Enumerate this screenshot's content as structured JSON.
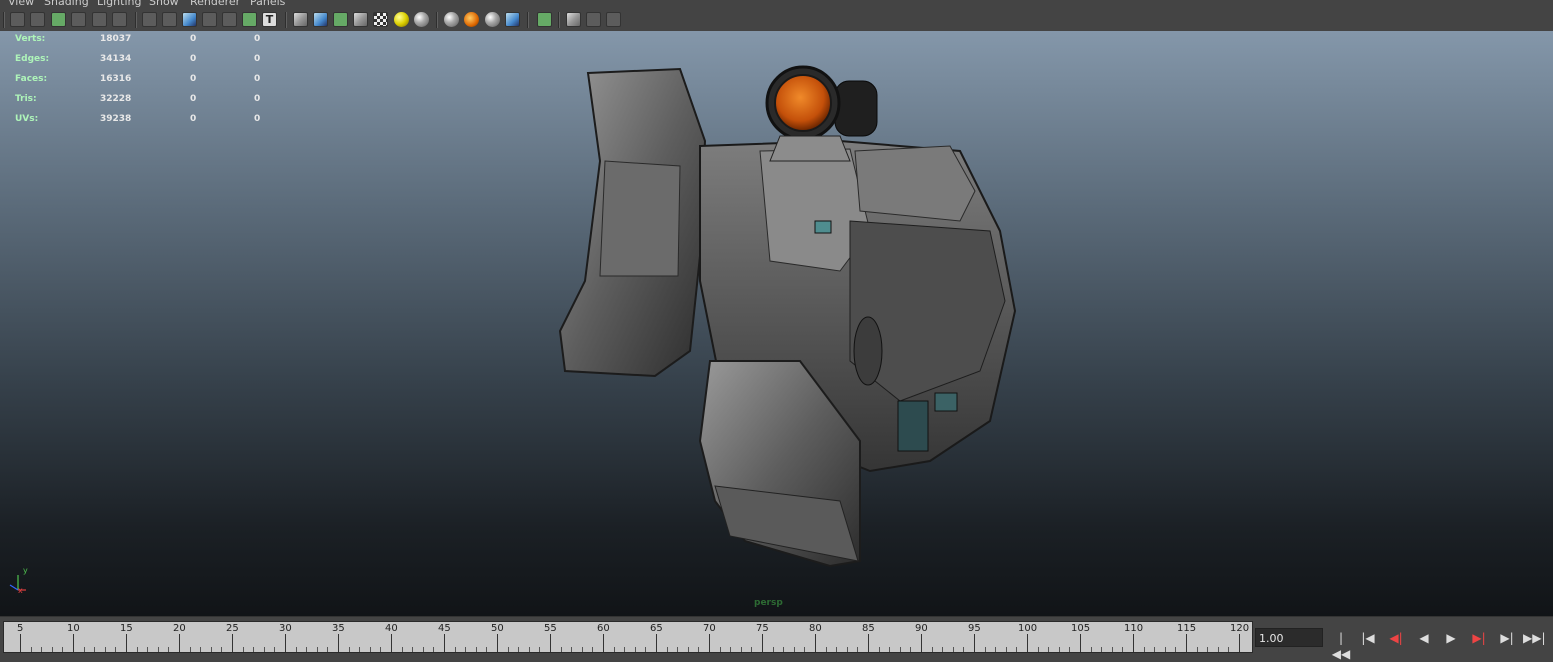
{
  "menu": [
    "View",
    "Shading",
    "Lighting",
    "Show",
    "Renderer",
    "Panels"
  ],
  "toolbar": {
    "groups": [
      [
        "camera-attributes-icon",
        "bookmark-icon",
        "image-plane-icon",
        "grid-icon",
        "film-gate-icon",
        "resolution-gate-icon"
      ],
      [
        "wireframe-icon",
        "smooth-shade-icon",
        "default-material-icon",
        "shade-selected-icon",
        "textured-icon",
        "use-all-lights-icon",
        "text-icon"
      ],
      [
        "wireframe-on-shaded-icon",
        "xray-icon",
        "xray-joints-icon",
        "xray-components-icon",
        "backface-culling-icon",
        "default-light-icon",
        "shadows-icon"
      ],
      [
        "screen-space-ao-icon",
        "motion-blur-icon",
        "multisample-aa-icon",
        "depth-of-field-icon"
      ],
      [
        "isolate-select-icon"
      ],
      [
        "single-view-icon",
        "two-view-icon",
        "hypershade-icon"
      ]
    ]
  },
  "hud": {
    "rows": [
      {
        "label": "Verts:",
        "value": "18037",
        "sel": "0",
        "comp": "0"
      },
      {
        "label": "Edges:",
        "value": "34134",
        "sel": "0",
        "comp": "0"
      },
      {
        "label": "Faces:",
        "value": "16316",
        "sel": "0",
        "comp": "0"
      },
      {
        "label": "Tris:",
        "value": "32228",
        "sel": "0",
        "comp": "0"
      },
      {
        "label": "UVs:",
        "value": "39238",
        "sel": "0",
        "comp": "0"
      }
    ]
  },
  "viewport": {
    "camera": "persp",
    "axis_y": "y",
    "axis_x": "x"
  },
  "timeline": {
    "ticks": [
      "5",
      "10",
      "15",
      "20",
      "25",
      "30",
      "35",
      "40",
      "45",
      "50",
      "55",
      "60",
      "65",
      "70",
      "75",
      "80",
      "85",
      "90",
      "95",
      "100",
      "105",
      "110",
      "115",
      "120"
    ],
    "current_time": "1.00"
  },
  "playback": {
    "buttons": [
      {
        "name": "go-to-start-button",
        "glyph": "|◀◀"
      },
      {
        "name": "step-back-key-button",
        "glyph": "|◀"
      },
      {
        "name": "step-back-frame-button",
        "glyph": "◀|"
      },
      {
        "name": "play-backwards-button",
        "glyph": "◀"
      },
      {
        "name": "play-forwards-button",
        "glyph": "▶"
      },
      {
        "name": "step-forward-frame-button",
        "glyph": "▶|"
      },
      {
        "name": "step-forward-key-button",
        "glyph": "▶|"
      },
      {
        "name": "go-to-end-button",
        "glyph": "▶▶|"
      }
    ]
  },
  "colors": {
    "hud_label": "#aef5b9",
    "accent_red": "#e44",
    "scope_lens": "#d65a0c"
  }
}
